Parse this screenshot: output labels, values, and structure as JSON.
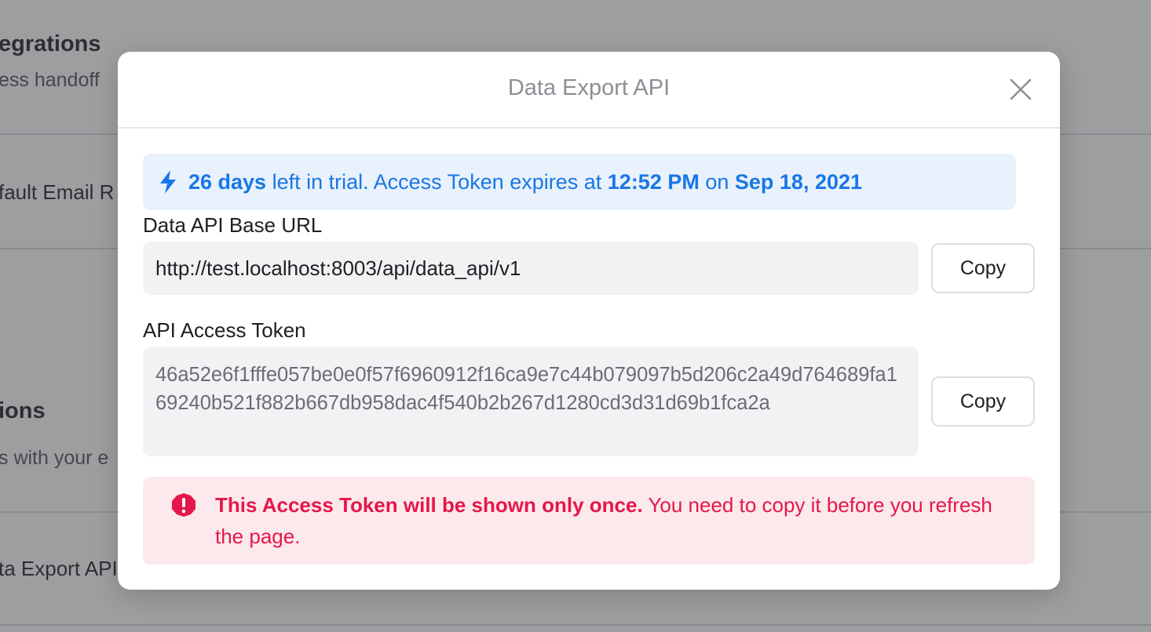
{
  "background": {
    "section1_title": "egrations",
    "section1_subtitle": "ess handoff",
    "row1_label": "fault Email R",
    "section2_title": "ions",
    "section2_subtitle": "s with your e",
    "row2_label": "ta Export API"
  },
  "modal": {
    "title": "Data Export API",
    "trial": {
      "days": "26 days",
      "text1": " left in trial. Access Token expires at ",
      "time": "12:52 PM",
      "text2": " on ",
      "date": "Sep 18, 2021"
    },
    "base_url": {
      "label": "Data API Base URL",
      "value": "http://test.localhost:8003/api/data_api/v1",
      "copy_label": "Copy"
    },
    "token": {
      "label": "API Access Token",
      "value": "46a52e6f1fffe057be0e0f57f6960912f16ca9e7c44b079097b5d206c2a49d764689fa169240b521f882b667db958dac4f540b2b267d1280cd3d31d69b1fca2a",
      "copy_label": "Copy"
    },
    "warning": {
      "bold": "This Access Token will be shown only once.",
      "rest": " You need to copy it before you refresh the page."
    }
  },
  "colors": {
    "accent": "#1977e5",
    "danger": "#e5174a",
    "trial_bg": "#e8f1fc",
    "warning_bg": "#fce9ec"
  },
  "icons": {
    "close": "close-icon",
    "bolt": "lightning-bolt-icon",
    "warning": "exclamation-circle-icon"
  }
}
